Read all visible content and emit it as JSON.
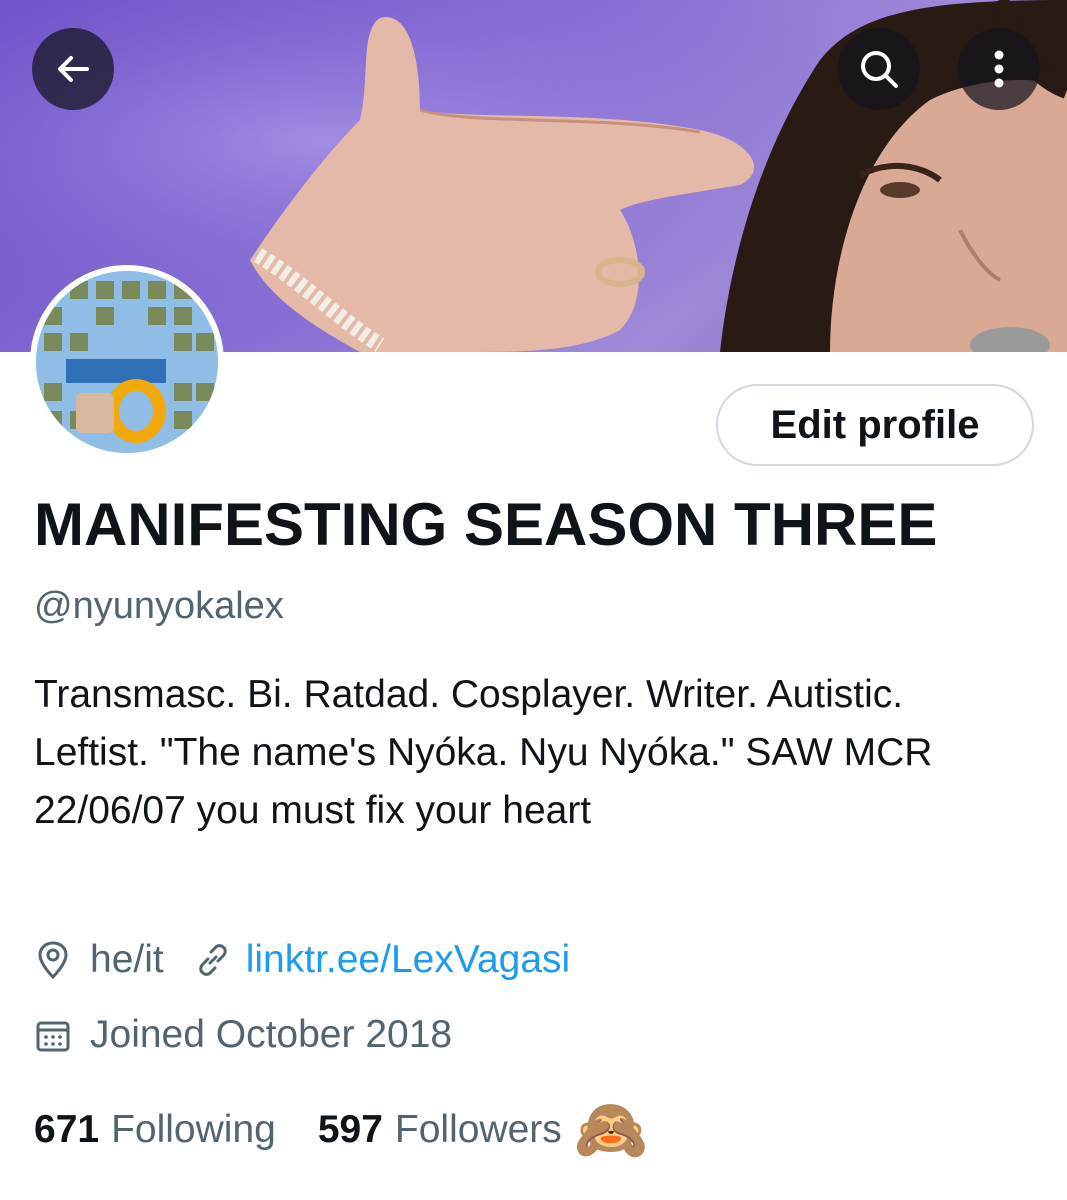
{
  "header": {
    "back_icon": "arrow-left-icon",
    "search_icon": "search-icon",
    "more_icon": "more-vertical-icon"
  },
  "profile": {
    "edit_label": "Edit profile",
    "display_name": "MANIFESTING SEASON THREE",
    "handle": "@nyunyokalex",
    "bio": "Transmasc. Bi. Ratdad. Cosplayer. Writer. Autistic. Leftist. \"The name's Nyóka. Nyu Nyóka.\" SAW MCR 22/06/07 you must fix your heart",
    "location": "he/it",
    "website": "linktr.ee/LexVagasi",
    "joined": "Joined October 2018"
  },
  "stats": {
    "following_count": "671",
    "following_label": "Following",
    "followers_count": "597",
    "followers_label": "Followers",
    "emoji": "🙈"
  },
  "colors": {
    "text_primary": "#0f1419",
    "text_secondary": "#536471",
    "link": "#1d9bf0",
    "border": "#cfd9de"
  }
}
